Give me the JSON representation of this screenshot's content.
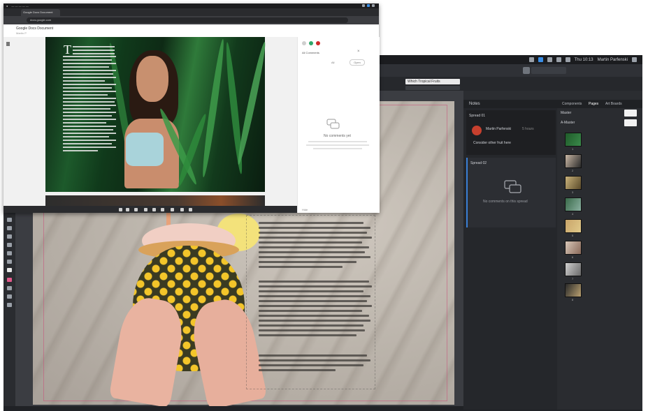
{
  "back_window": {
    "menubar": {
      "clock": "Thu 10:13",
      "user": "Martin Parfenski"
    },
    "document_tab": "Which Tropical Fruits",
    "comments_panel": {
      "header": "Notes",
      "spread1_label": "Spread 01",
      "comment_author": "Martin Parfenski",
      "comment_time": "5 hours",
      "comment_text": "Consider other fruit here",
      "spread2_label": "Spread 02",
      "empty_text": "No comments on this spread"
    },
    "pages_panel": {
      "tabs": [
        "Components",
        "Pages",
        "Art Boards"
      ],
      "active_tab": "Pages",
      "row_labels": [
        "Master",
        "A-Master"
      ],
      "thumb_numbers": [
        "1",
        "2",
        "3",
        "4",
        "5",
        "6",
        "7",
        "8"
      ]
    },
    "accent_color": "#3a7fd6"
  },
  "front_window": {
    "chrome_tab": "Google Docs Document",
    "url": "docs.google.com",
    "doc_title": "Google Docs Document",
    "doc_subtitle": "Martin P",
    "first_letter": "T",
    "side_panel": {
      "title": "All Comments",
      "filter": "All",
      "button": "Open",
      "empty_title": "No comments yet",
      "footer": "Hide"
    }
  }
}
